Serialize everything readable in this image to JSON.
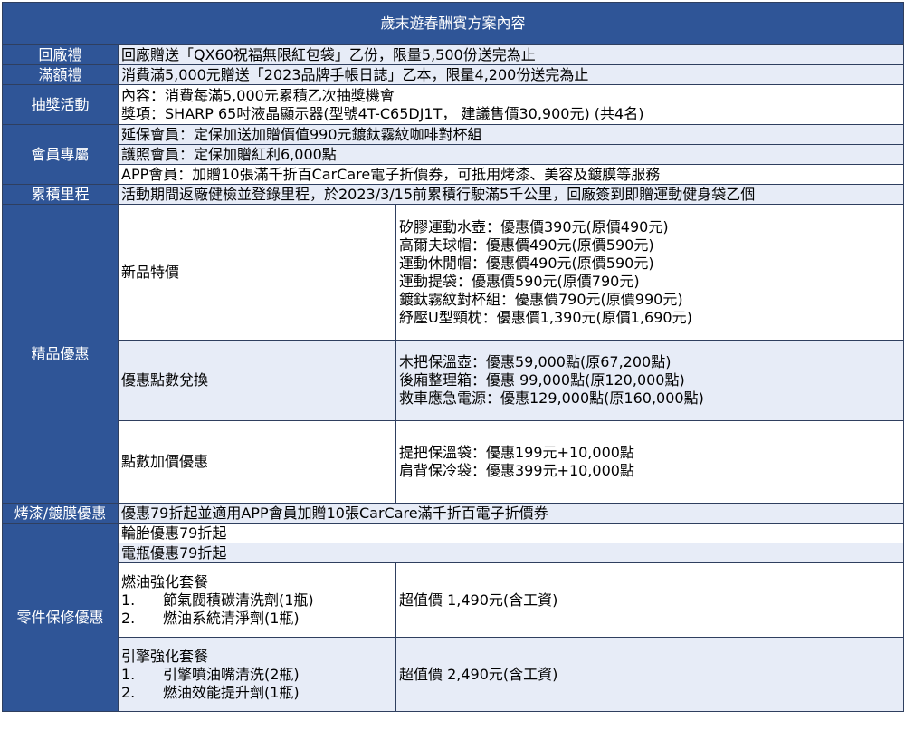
{
  "title": "歲末遊春酬賓方案內容",
  "gift_return": {
    "label": "回廠禮",
    "text": "回廠贈送「QX60祝福無限紅包袋」乙份，限量5,500份送完為止"
  },
  "gift_spend": {
    "label": "滿額禮",
    "text": "消費滿5,000元贈送「2023品牌手帳日誌」乙本，限量4,200份送完為止"
  },
  "lottery": {
    "label": "抽獎活動",
    "lines": [
      "內容：消費每滿5,000元累積乙次抽獎機會",
      "獎項：SHARP 65吋液晶顯示器(型號4T-C65DJ1T， 建議售價30,900元) (共4名)"
    ]
  },
  "member": {
    "label": "會員專屬",
    "rows": [
      "延保會員：定保加送加贈價值990元鍍鈦霧紋咖啡對杯組",
      "護照會員：定保加贈紅利6,000點",
      "APP會員：加贈10張滿千折百CarCare電子折價券，可抵用烤漆、美容及鍍膜等服務"
    ]
  },
  "mileage": {
    "label": "累積里程",
    "text": "活動期間返廠健檢並登錄里程，於2023/3/15前累積行駛滿5千公里，回廠簽到即贈運動健身袋乙個"
  },
  "boutique": {
    "label": "精品優惠",
    "new_items": {
      "name": "新品特價",
      "lines": [
        "矽膠運動水壺：優惠價390元(原價490元)",
        "高爾夫球帽：優惠價490元(原價590元)",
        "運動休閒帽：優惠價490元(原價590元)",
        "運動提袋：優惠價590元(原價790元)",
        "鍍鈦霧紋對杯組：優惠價790元(原價990元)",
        "紓壓U型頸枕：優惠價1,390元(原價1,690元)"
      ]
    },
    "points": {
      "name": "優惠點數兌換",
      "lines": [
        "木把保溫壺：優惠59,000點(原67,200點)",
        "後廂整理箱：優惠 99,000點(原120,000點)",
        "救車應急電源：優惠129,000點(原160,000點)"
      ]
    },
    "points_plus": {
      "name": "點數加價優惠",
      "lines": [
        "提把保溫袋：優惠199元+10,000點",
        "肩背保冷袋：優惠399元+10,000點"
      ]
    }
  },
  "paint": {
    "label": "烤漆/鍍膜優惠",
    "text": "優惠79折起並適用APP會員加贈10張CarCare滿千折百電子折價券"
  },
  "parts": {
    "label": "零件保修優惠",
    "tire": "輪胎優惠79折起",
    "battery": "電瓶優惠79折起",
    "fuel": {
      "title": "燃油強化套餐",
      "items": [
        {
          "num": "1.",
          "text": "節氣閥積碳清洗劑(1瓶)"
        },
        {
          "num": "2.",
          "text": "燃油系統清淨劑(1瓶)"
        }
      ],
      "price": "超值價 1,490元(含工資)"
    },
    "engine": {
      "title": "引擎強化套餐",
      "items": [
        {
          "num": "1.",
          "text": "引擎噴油嘴清洗(2瓶)"
        },
        {
          "num": "2.",
          "text": "燃油效能提升劑(1瓶)"
        }
      ],
      "price": "超值價 2,490元(含工資)"
    }
  }
}
